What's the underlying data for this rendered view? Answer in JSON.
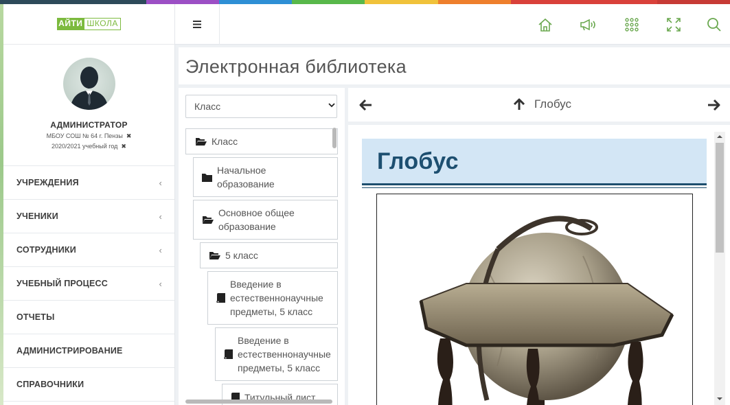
{
  "colors": {
    "stripe": [
      "#2d4a5a",
      "#9c4fc5",
      "#2e8fd5",
      "#58b84a",
      "#f0c23a",
      "#ee7f2c",
      "#d9413a"
    ],
    "accent_green": "#6aa84f"
  },
  "logo": {
    "part1": "АЙТИ",
    "part2": "ШКОЛА"
  },
  "profile": {
    "name": "АДМИНИСТРАТОР",
    "school": "МБОУ СОШ № 64 г. Пензы",
    "year": "2020/2021 учебный год",
    "remove_icon": "✖"
  },
  "menu": [
    {
      "label": "УЧРЕЖДЕНИЯ",
      "chevron": "‹"
    },
    {
      "label": "УЧЕНИКИ",
      "chevron": "‹"
    },
    {
      "label": "СОТРУДНИКИ",
      "chevron": "‹"
    },
    {
      "label": "УЧЕБНЫЙ ПРОЦЕСС",
      "chevron": "‹"
    },
    {
      "label": "ОТЧЕТЫ",
      "chevron": ""
    },
    {
      "label": "АДМИНИСТРИРОВАНИЕ",
      "chevron": ""
    },
    {
      "label": "СПРАВОЧНИКИ",
      "chevron": ""
    }
  ],
  "header": {
    "icons": [
      "home-icon",
      "megaphone-icon",
      "apps-grid-icon",
      "fullscreen-icon",
      "search-icon"
    ]
  },
  "page": {
    "title": "Электронная библиотека"
  },
  "tree": {
    "select_value": "Класс",
    "nodes": [
      {
        "label": "Класс",
        "icon": "folder-open-icon"
      },
      {
        "label": "Начальное образование",
        "icon": "folder-icon"
      },
      {
        "label": "Основное общее образование",
        "icon": "folder-open-icon"
      },
      {
        "label": "5 класс",
        "icon": "folder-open-icon"
      },
      {
        "label": "Введение в естественнонаучные предметы, 5 класс",
        "icon": "book-icon"
      },
      {
        "label": "Введение в естественнонаучные предметы, 5 класс",
        "icon": "book-icon"
      },
      {
        "label": "Титульный лист",
        "icon": "book-icon"
      }
    ]
  },
  "nav": {
    "current": "Глобус"
  },
  "document": {
    "heading": "Глобус"
  }
}
